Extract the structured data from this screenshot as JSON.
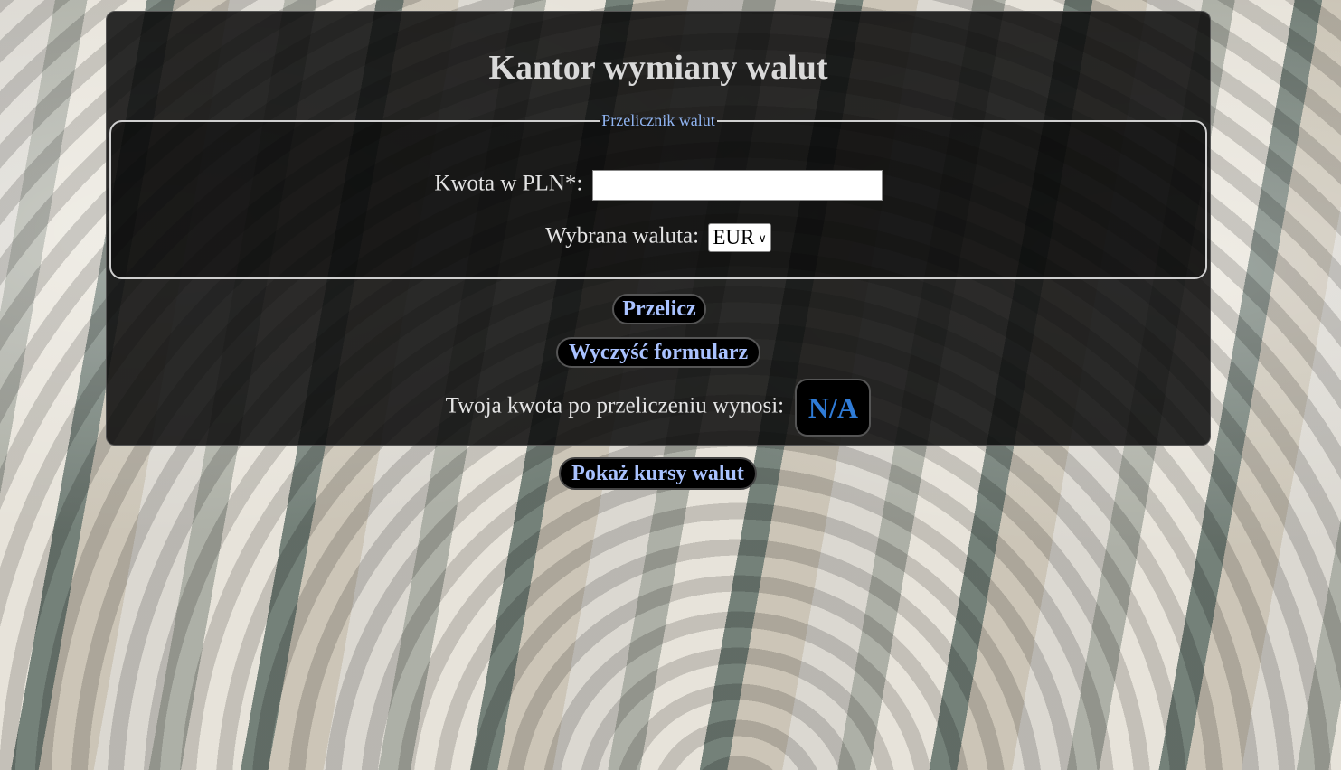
{
  "title": "Kantor wymiany walut",
  "converter": {
    "legend": "Przelicznik walut",
    "amount_label": "Kwota w PLN*:",
    "amount_value": "",
    "currency_label": "Wybrana waluta:",
    "currency_selected": "EUR"
  },
  "buttons": {
    "calculate": "Przelicz",
    "clear": "Wyczyść formularz",
    "show_rates": "Pokaż kursy walut"
  },
  "result": {
    "label": "Twoja kwota po przeliczeniu wynosi:",
    "value": "N/A"
  },
  "colors": {
    "accent_text": "#a9c2ff",
    "result_value": "#2f7bd6",
    "legend": "#8fb3f0"
  }
}
